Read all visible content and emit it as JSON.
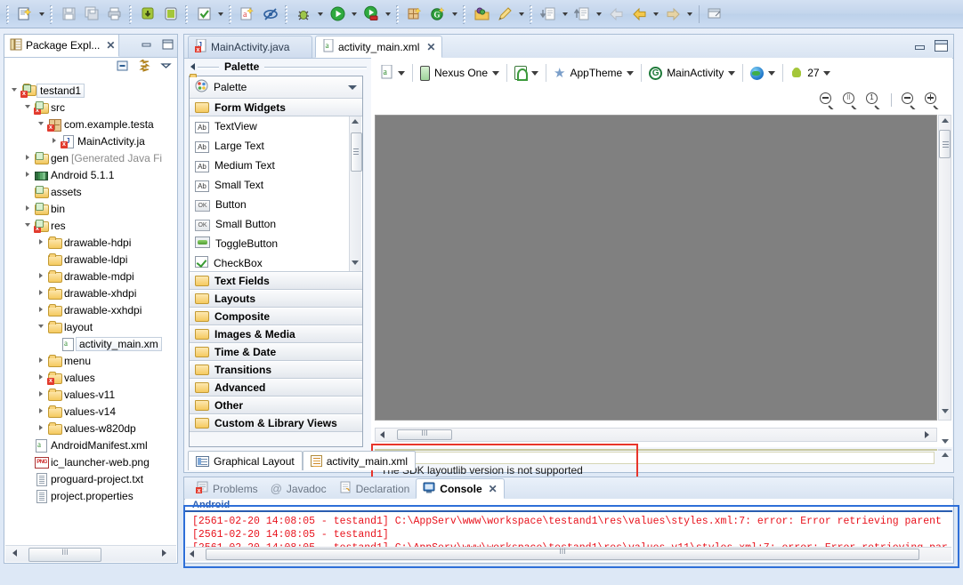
{
  "toolbar": {
    "icons": [
      {
        "name": "new-wizard-icon",
        "glyph": "🗋",
        "has_dropdown": true
      },
      {
        "name": "save-icon",
        "glyph": "💾",
        "has_dropdown": false
      },
      {
        "name": "save-all-icon",
        "glyph": "🗐",
        "has_dropdown": false
      },
      {
        "name": "print-icon",
        "glyph": "🖶",
        "has_dropdown": false
      },
      {
        "name": "android-sdk-manager-icon",
        "glyph": "🤖",
        "has_dropdown": false
      },
      {
        "name": "android-avd-manager-icon",
        "glyph": "📱",
        "has_dropdown": false
      },
      {
        "name": "check-build-icon",
        "glyph": "☑",
        "has_dropdown": true
      },
      {
        "name": "new-android-project-icon",
        "glyph": "🅰",
        "has_dropdown": false
      },
      {
        "name": "no-lint-icon",
        "glyph": "🚫",
        "has_dropdown": false
      },
      {
        "name": "debug-icon",
        "glyph": "🐞",
        "has_dropdown": true
      },
      {
        "name": "run-icon",
        "glyph": "▶",
        "has_dropdown": true
      },
      {
        "name": "run-external-tools-icon",
        "glyph": "▶",
        "has_dropdown": true
      },
      {
        "name": "new-java-package-icon",
        "glyph": "🎁",
        "has_dropdown": false
      },
      {
        "name": "new-class-icon",
        "glyph": "Ⓖ",
        "has_dropdown": true
      },
      {
        "name": "open-type-icon",
        "glyph": "📂",
        "has_dropdown": false
      },
      {
        "name": "search-icon",
        "glyph": "🖊",
        "has_dropdown": true
      },
      {
        "name": "next-annotation-icon",
        "glyph": "📄",
        "has_dropdown": true
      },
      {
        "name": "previous-annotation-icon",
        "glyph": "📄",
        "has_dropdown": true
      },
      {
        "name": "back-disabled-icon",
        "glyph": "⬅",
        "has_dropdown": false
      },
      {
        "name": "back-icon",
        "glyph": "⬅",
        "has_dropdown": true
      },
      {
        "name": "forward-icon",
        "glyph": "➡",
        "has_dropdown": true
      },
      {
        "name": "open-perspective-icon",
        "glyph": "🗔",
        "has_dropdown": false
      }
    ]
  },
  "package_explorer": {
    "tab_title": "Package Expl...",
    "close_glyph": "✕",
    "minimize_tooltip": "Minimize",
    "maximize_tooltip": "Maximize",
    "tools": [
      "collapse-all",
      "link-with-editor",
      "view-menu"
    ],
    "tree": [
      {
        "label": "testand1",
        "indent": 0,
        "twisty": "open",
        "icon": "android-project",
        "selected": true,
        "error": true
      },
      {
        "label": "src",
        "indent": 1,
        "twisty": "open",
        "icon": "source-folder",
        "error": true
      },
      {
        "label": "com.example.testa",
        "indent": 2,
        "twisty": "open",
        "icon": "package",
        "error": true
      },
      {
        "label": "MainActivity.ja",
        "indent": 3,
        "twisty": "closed",
        "icon": "java-file",
        "error": true
      },
      {
        "label": "gen",
        "suffix": "[Generated Java Fi",
        "indent": 1,
        "twisty": "closed",
        "icon": "source-folder"
      },
      {
        "label": "Android 5.1.1",
        "indent": 1,
        "twisty": "closed",
        "icon": "library"
      },
      {
        "label": "assets",
        "indent": 1,
        "twisty": "none",
        "icon": "folder-plain"
      },
      {
        "label": "bin",
        "indent": 1,
        "twisty": "closed",
        "icon": "folder-plain"
      },
      {
        "label": "res",
        "indent": 1,
        "twisty": "open",
        "icon": "folder-plain",
        "error": true
      },
      {
        "label": "drawable-hdpi",
        "indent": 2,
        "twisty": "closed",
        "icon": "folder"
      },
      {
        "label": "drawable-ldpi",
        "indent": 2,
        "twisty": "none",
        "icon": "folder"
      },
      {
        "label": "drawable-mdpi",
        "indent": 2,
        "twisty": "closed",
        "icon": "folder"
      },
      {
        "label": "drawable-xhdpi",
        "indent": 2,
        "twisty": "closed",
        "icon": "folder"
      },
      {
        "label": "drawable-xxhdpi",
        "indent": 2,
        "twisty": "closed",
        "icon": "folder"
      },
      {
        "label": "layout",
        "indent": 2,
        "twisty": "open",
        "icon": "folder"
      },
      {
        "label": "activity_main.xm",
        "indent": 3,
        "twisty": "none",
        "icon": "xml-file",
        "highlight": true
      },
      {
        "label": "menu",
        "indent": 2,
        "twisty": "closed",
        "icon": "folder"
      },
      {
        "label": "values",
        "indent": 2,
        "twisty": "closed",
        "icon": "folder",
        "error": true
      },
      {
        "label": "values-v11",
        "indent": 2,
        "twisty": "closed",
        "icon": "folder"
      },
      {
        "label": "values-v14",
        "indent": 2,
        "twisty": "closed",
        "icon": "folder"
      },
      {
        "label": "values-w820dp",
        "indent": 2,
        "twisty": "closed",
        "icon": "folder"
      },
      {
        "label": "AndroidManifest.xml",
        "indent": 1,
        "twisty": "none",
        "icon": "xml-file"
      },
      {
        "label": "ic_launcher-web.png",
        "indent": 1,
        "twisty": "none",
        "icon": "png-file"
      },
      {
        "label": "proguard-project.txt",
        "indent": 1,
        "twisty": "none",
        "icon": "text-file"
      },
      {
        "label": "project.properties",
        "indent": 1,
        "twisty": "none",
        "icon": "text-file"
      }
    ]
  },
  "editor": {
    "tabs": [
      {
        "label": "MainActivity.java",
        "active": false,
        "icon": "java-file-error",
        "closable": false
      },
      {
        "label": "activity_main.xml",
        "active": true,
        "icon": "xml-file",
        "closable": true,
        "close_glyph": "✕"
      }
    ],
    "palette": {
      "header_title": "Palette",
      "selector_label": "Palette",
      "categories": [
        {
          "label": "Form Widgets",
          "expanded": true,
          "items": [
            {
              "label": "TextView",
              "icon": "ab-icon",
              "icon_text": "Ab"
            },
            {
              "label": "Large Text",
              "icon": "ab-icon",
              "icon_text": "Ab"
            },
            {
              "label": "Medium Text",
              "icon": "ab-icon",
              "icon_text": "Ab"
            },
            {
              "label": "Small Text",
              "icon": "ab-icon",
              "icon_text": "Ab"
            },
            {
              "label": "Button",
              "icon": "ok-icon",
              "icon_text": "OK"
            },
            {
              "label": "Small Button",
              "icon": "ok-icon",
              "icon_text": "OK"
            },
            {
              "label": "ToggleButton",
              "icon": "toggle-icon",
              "icon_text": ""
            },
            {
              "label": "CheckBox",
              "icon": "checkbox-icon",
              "icon_text": ""
            }
          ]
        },
        {
          "label": "Text Fields",
          "expanded": false,
          "items": []
        },
        {
          "label": "Layouts",
          "expanded": false,
          "items": []
        },
        {
          "label": "Composite",
          "expanded": false,
          "items": []
        },
        {
          "label": "Images & Media",
          "expanded": false,
          "items": []
        },
        {
          "label": "Time & Date",
          "expanded": false,
          "items": []
        },
        {
          "label": "Transitions",
          "expanded": false,
          "items": []
        },
        {
          "label": "Advanced",
          "expanded": false,
          "items": []
        },
        {
          "label": "Other",
          "expanded": false,
          "items": []
        },
        {
          "label": "Custom & Library Views",
          "expanded": false,
          "items": []
        }
      ]
    },
    "layout_toolbar": {
      "config_label": "",
      "device_label": "Nexus One",
      "orientation_label": "",
      "theme_label": "AppTheme",
      "activity_label": "MainActivity",
      "locale_label": "",
      "api_label": "27"
    },
    "zoom_buttons": [
      {
        "name": "zoom-out-to-fit-icon",
        "kind": "fit-width"
      },
      {
        "name": "zoom-fit-icon",
        "kind": "fit"
      },
      {
        "name": "zoom-100-icon",
        "kind": "one",
        "label": "1"
      },
      {
        "name": "zoom-out-icon",
        "kind": "minus"
      },
      {
        "name": "zoom-in-icon",
        "kind": "plus"
      }
    ],
    "error_message": "The SDK layoutlib version is not supported",
    "bottom_tabs": [
      {
        "label": "Graphical Layout",
        "active": true,
        "icon": "graphical-layout-icon"
      },
      {
        "label": "activity_main.xml",
        "active": false,
        "icon": "xml-source-icon"
      }
    ]
  },
  "console": {
    "tabs": [
      {
        "label": "Problems",
        "active": false,
        "icon": "problems-icon"
      },
      {
        "label": "Javadoc",
        "active": false,
        "icon": "javadoc-icon"
      },
      {
        "label": "Declaration",
        "active": false,
        "icon": "declaration-icon"
      },
      {
        "label": "Console",
        "active": true,
        "icon": "console-icon",
        "close_glyph": "✕"
      }
    ],
    "stream_name": "Android",
    "lines": [
      "[2561-02-20 14:08:05 - testand1] C:\\AppServ\\www\\workspace\\testand1\\res\\values\\styles.xml:7: error: Error retrieving parent",
      "[2561-02-20 14:08:05 - testand1]",
      "[2561-02-20 14:08:05 - testand1] C:\\AppServ\\www\\workspace\\testand1\\res\\values-v11\\styles.xml:7: error: Error retrieving par"
    ]
  },
  "colors": {
    "error_highlight": "#e8352a",
    "console_highlight": "#2e6fd8",
    "console_text": "#e8131d",
    "chrome": "#c3d5ec",
    "error_panel_bg": "#ffffd9",
    "canvas_bg": "#808080"
  }
}
